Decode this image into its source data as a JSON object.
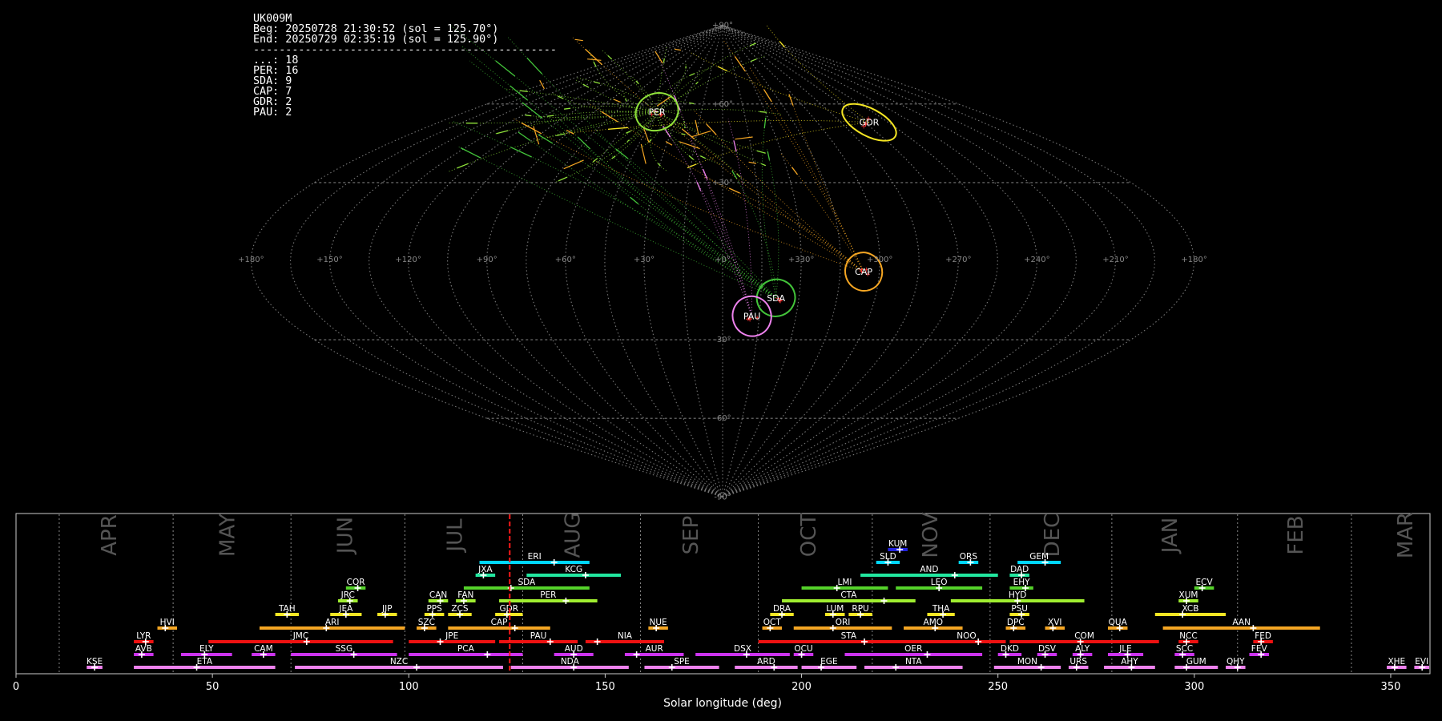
{
  "info": {
    "station": "UK009M",
    "beg": "Beg: 20250728 21:30:52 (sol = 125.70°)",
    "end": "End: 20250729 02:35:19 (sol = 125.90°)",
    "separator": "-----------------------------------------------",
    "counts": [
      "...: 18",
      "PER: 16",
      "SDA: 9",
      "CAP: 7",
      "GDR: 2",
      "PAU: 2"
    ]
  },
  "colors": {
    "grid": "#777777",
    "PER": "#8fe23a",
    "SDA": "#43c43a",
    "CAP": "#f5a623",
    "GDR": "#f5e623",
    "PAU": "#ee82ee",
    "sporadic": "#f5a623",
    "marker": "#ff3030"
  },
  "sky_map": {
    "projection": "sinusoidal",
    "lon_labels": [
      "+180°",
      "+150°",
      "+120°",
      "+90°",
      "+60°",
      "+30°",
      "+0°",
      "+330°",
      "+300°",
      "+270°",
      "+240°",
      "+210°",
      "+180°"
    ],
    "lat_labels": [
      "+90°",
      "+60°",
      "+30°",
      "-30°",
      "-60°",
      "-90°"
    ],
    "radiants": [
      {
        "code": "PER",
        "lon": 46,
        "lat": 57,
        "rx": 27,
        "ry": 23,
        "color": "#8fe23a"
      },
      {
        "code": "GDR",
        "lon": 267,
        "lat": 53,
        "rx": 37,
        "ry": 17,
        "color": "#f5e623"
      },
      {
        "code": "CAP",
        "lon": 306,
        "lat": -4,
        "rx": 23,
        "ry": 24,
        "color": "#f5a623"
      },
      {
        "code": "SDA",
        "lon": 339,
        "lat": -14,
        "rx": 24,
        "ry": 23,
        "color": "#43c43a"
      },
      {
        "code": "PAU",
        "lon": 348,
        "lat": -21,
        "rx": 24,
        "ry": 25,
        "color": "#ee82ee"
      }
    ]
  },
  "chart_data": {
    "type": "bar",
    "xlabel": "Solar longitude (deg)",
    "xlim": [
      0,
      360
    ],
    "xticks": [
      0,
      50,
      100,
      150,
      200,
      250,
      300,
      350
    ],
    "current_sol": 125.7,
    "months": [
      {
        "name": "APR",
        "sol": 24
      },
      {
        "name": "MAY",
        "sol": 54
      },
      {
        "name": "JUN",
        "sol": 84
      },
      {
        "name": "JUL",
        "sol": 112
      },
      {
        "name": "AUG",
        "sol": 142
      },
      {
        "name": "SEP",
        "sol": 172
      },
      {
        "name": "OCT",
        "sol": 202
      },
      {
        "name": "NOV",
        "sol": 233
      },
      {
        "name": "DEC",
        "sol": 264
      },
      {
        "name": "JAN",
        "sol": 294
      },
      {
        "name": "FEB",
        "sol": 326
      },
      {
        "name": "MAR",
        "sol": 354
      }
    ],
    "month_boundaries": [
      11,
      40,
      70,
      99,
      129,
      159,
      189,
      218,
      248,
      279,
      311,
      340
    ],
    "showers": [
      {
        "code": "KUM",
        "start": 222,
        "end": 227,
        "peak": 225,
        "row": 0,
        "color": "#2222dd"
      },
      {
        "code": "ERI",
        "start": 118,
        "end": 146,
        "peak": 137,
        "row": 1,
        "color": "#00d7ff"
      },
      {
        "code": "SLD",
        "start": 219,
        "end": 225,
        "peak": 222,
        "row": 1,
        "color": "#00d7ff"
      },
      {
        "code": "ORS",
        "start": 240,
        "end": 245,
        "peak": 243,
        "row": 1,
        "color": "#00d7ff"
      },
      {
        "code": "GEM",
        "start": 255,
        "end": 266,
        "peak": 262,
        "row": 1,
        "color": "#00d7ff"
      },
      {
        "code": "JXA",
        "start": 117,
        "end": 122,
        "peak": 119,
        "row": 2,
        "color": "#22e8a0"
      },
      {
        "code": "KCG",
        "start": 130,
        "end": 154,
        "peak": 145,
        "row": 2,
        "color": "#22e8a0"
      },
      {
        "code": "AND",
        "start": 215,
        "end": 250,
        "peak": 239,
        "row": 2,
        "color": "#22e8a0"
      },
      {
        "code": "DAD",
        "start": 253,
        "end": 258,
        "peak": 256,
        "row": 2,
        "color": "#22e8a0"
      },
      {
        "code": "COR",
        "start": 84,
        "end": 89,
        "peak": 87,
        "row": 3,
        "color": "#55d22a"
      },
      {
        "code": "SDA",
        "start": 114,
        "end": 146,
        "peak": 126,
        "row": 3,
        "color": "#55d22a"
      },
      {
        "code": "LMI",
        "start": 200,
        "end": 222,
        "peak": 209,
        "row": 3,
        "color": "#55d22a"
      },
      {
        "code": "LEO",
        "start": 224,
        "end": 246,
        "peak": 235,
        "row": 3,
        "color": "#55d22a"
      },
      {
        "code": "EHY",
        "start": 253,
        "end": 259,
        "peak": 257,
        "row": 3,
        "color": "#55d22a"
      },
      {
        "code": "ECV",
        "start": 300,
        "end": 305,
        "peak": 302,
        "row": 3,
        "color": "#55d22a"
      },
      {
        "code": "JRC",
        "start": 82,
        "end": 87,
        "peak": 85,
        "row": 4,
        "color": "#a0ee30"
      },
      {
        "code": "CAN",
        "start": 105,
        "end": 110,
        "peak": 108,
        "row": 4,
        "color": "#a0ee30"
      },
      {
        "code": "FAN",
        "start": 112,
        "end": 117,
        "peak": 114,
        "row": 4,
        "color": "#a0ee30"
      },
      {
        "code": "PER",
        "start": 123,
        "end": 148,
        "peak": 140,
        "row": 4,
        "color": "#a0ee30"
      },
      {
        "code": "CTA",
        "start": 195,
        "end": 229,
        "peak": 221,
        "row": 4,
        "color": "#a0ee30"
      },
      {
        "code": "HYD",
        "start": 238,
        "end": 272,
        "peak": 255,
        "row": 4,
        "color": "#a0ee30"
      },
      {
        "code": "XUM",
        "start": 296,
        "end": 301,
        "peak": 298,
        "row": 4,
        "color": "#a0ee30"
      },
      {
        "code": "TAH",
        "start": 66,
        "end": 72,
        "peak": 69,
        "row": 5,
        "color": "#f5e623"
      },
      {
        "code": "JEA",
        "start": 80,
        "end": 88,
        "peak": 84,
        "row": 5,
        "color": "#f5e623"
      },
      {
        "code": "JIP",
        "start": 92,
        "end": 97,
        "peak": 94,
        "row": 5,
        "color": "#f5e623"
      },
      {
        "code": "PPS",
        "start": 104,
        "end": 109,
        "peak": 106,
        "row": 5,
        "color": "#f5e623"
      },
      {
        "code": "ZCS",
        "start": 110,
        "end": 116,
        "peak": 113,
        "row": 5,
        "color": "#f5e623"
      },
      {
        "code": "GDR",
        "start": 122,
        "end": 129,
        "peak": 125,
        "row": 5,
        "color": "#f5e623"
      },
      {
        "code": "DRA",
        "start": 192,
        "end": 198,
        "peak": 195,
        "row": 5,
        "color": "#f5e623"
      },
      {
        "code": "LUM",
        "start": 206,
        "end": 211,
        "peak": 208,
        "row": 5,
        "color": "#f5e623"
      },
      {
        "code": "RPU",
        "start": 212,
        "end": 218,
        "peak": 215,
        "row": 5,
        "color": "#f5e623"
      },
      {
        "code": "THA",
        "start": 232,
        "end": 239,
        "peak": 236,
        "row": 5,
        "color": "#f5e623"
      },
      {
        "code": "PSU",
        "start": 253,
        "end": 258,
        "peak": 256,
        "row": 5,
        "color": "#f5e623"
      },
      {
        "code": "XCB",
        "start": 290,
        "end": 308,
        "peak": 297,
        "row": 5,
        "color": "#f5e623"
      },
      {
        "code": "HVI",
        "start": 36,
        "end": 41,
        "peak": 38,
        "row": 6,
        "color": "#f5a623"
      },
      {
        "code": "ARI",
        "start": 62,
        "end": 99,
        "peak": 79,
        "row": 6,
        "color": "#f5a623"
      },
      {
        "code": "SZC",
        "start": 102,
        "end": 107,
        "peak": 104,
        "row": 6,
        "color": "#f5a623"
      },
      {
        "code": "CAP",
        "start": 110,
        "end": 136,
        "peak": 127,
        "row": 6,
        "color": "#f5a623"
      },
      {
        "code": "NUE",
        "start": 161,
        "end": 166,
        "peak": 163,
        "row": 6,
        "color": "#f5a623"
      },
      {
        "code": "OCT",
        "start": 190,
        "end": 195,
        "peak": 192,
        "row": 6,
        "color": "#f5a623"
      },
      {
        "code": "ORI",
        "start": 198,
        "end": 223,
        "peak": 208,
        "row": 6,
        "color": "#f5a623"
      },
      {
        "code": "AMO",
        "start": 226,
        "end": 241,
        "peak": 234,
        "row": 6,
        "color": "#f5a623"
      },
      {
        "code": "DPC",
        "start": 252,
        "end": 257,
        "peak": 254,
        "row": 6,
        "color": "#f5a623"
      },
      {
        "code": "XVI",
        "start": 262,
        "end": 267,
        "peak": 264,
        "row": 6,
        "color": "#f5a623"
      },
      {
        "code": "QUA",
        "start": 278,
        "end": 283,
        "peak": 281,
        "row": 6,
        "color": "#f5a623"
      },
      {
        "code": "AAN",
        "start": 292,
        "end": 332,
        "peak": 315,
        "row": 6,
        "color": "#f5a623"
      },
      {
        "code": "LYR",
        "start": 30,
        "end": 35,
        "peak": 33,
        "row": 7,
        "color": "#ee1111"
      },
      {
        "code": "JMC",
        "start": 49,
        "end": 96,
        "peak": 74,
        "row": 7,
        "color": "#ee1111"
      },
      {
        "code": "JPE",
        "start": 100,
        "end": 122,
        "peak": 108,
        "row": 7,
        "color": "#ee1111"
      },
      {
        "code": "PAU",
        "start": 123,
        "end": 143,
        "peak": 136,
        "row": 7,
        "color": "#ee1111"
      },
      {
        "code": "NIA",
        "start": 145,
        "end": 165,
        "peak": 148,
        "row": 7,
        "color": "#ee1111"
      },
      {
        "code": "STA",
        "start": 189,
        "end": 235,
        "peak": 216,
        "row": 7,
        "color": "#ee1111"
      },
      {
        "code": "NOO",
        "start": 232,
        "end": 252,
        "peak": 245,
        "row": 7,
        "color": "#ee1111"
      },
      {
        "code": "COM",
        "start": 253,
        "end": 291,
        "peak": 271,
        "row": 7,
        "color": "#ee1111"
      },
      {
        "code": "NCC",
        "start": 296,
        "end": 301,
        "peak": 298,
        "row": 7,
        "color": "#ee1111"
      },
      {
        "code": "FED",
        "start": 315,
        "end": 320,
        "peak": 317,
        "row": 7,
        "color": "#ee1111"
      },
      {
        "code": "AVB",
        "start": 30,
        "end": 35,
        "peak": 32,
        "row": 8,
        "color": "#cc33ee"
      },
      {
        "code": "ELY",
        "start": 42,
        "end": 55,
        "peak": 48,
        "row": 8,
        "color": "#cc33ee"
      },
      {
        "code": "CAM",
        "start": 60,
        "end": 66,
        "peak": 63,
        "row": 8,
        "color": "#cc33ee"
      },
      {
        "code": "SSG",
        "start": 70,
        "end": 97,
        "peak": 86,
        "row": 8,
        "color": "#cc33ee"
      },
      {
        "code": "PCA",
        "start": 100,
        "end": 129,
        "peak": 120,
        "row": 8,
        "color": "#cc33ee"
      },
      {
        "code": "AUD",
        "start": 137,
        "end": 147,
        "peak": 142,
        "row": 8,
        "color": "#cc33ee"
      },
      {
        "code": "AUR",
        "start": 155,
        "end": 170,
        "peak": 158,
        "row": 8,
        "color": "#cc33ee"
      },
      {
        "code": "DSX",
        "start": 173,
        "end": 197,
        "peak": 186,
        "row": 8,
        "color": "#cc33ee"
      },
      {
        "code": "OCU",
        "start": 198,
        "end": 203,
        "peak": 200,
        "row": 8,
        "color": "#cc33ee"
      },
      {
        "code": "OER",
        "start": 211,
        "end": 246,
        "peak": 232,
        "row": 8,
        "color": "#cc33ee"
      },
      {
        "code": "DKD",
        "start": 250,
        "end": 256,
        "peak": 252,
        "row": 8,
        "color": "#cc33ee"
      },
      {
        "code": "DSV",
        "start": 260,
        "end": 265,
        "peak": 262,
        "row": 8,
        "color": "#cc33ee"
      },
      {
        "code": "ALY",
        "start": 269,
        "end": 274,
        "peak": 271,
        "row": 8,
        "color": "#cc33ee"
      },
      {
        "code": "JLE",
        "start": 278,
        "end": 287,
        "peak": 283,
        "row": 8,
        "color": "#cc33ee"
      },
      {
        "code": "SCC",
        "start": 295,
        "end": 300,
        "peak": 297,
        "row": 8,
        "color": "#cc33ee"
      },
      {
        "code": "FEV",
        "start": 314,
        "end": 319,
        "peak": 317,
        "row": 8,
        "color": "#cc33ee"
      },
      {
        "code": "KSE",
        "start": 18,
        "end": 22,
        "peak": 20,
        "row": 9,
        "color": "#ee82ee"
      },
      {
        "code": "ETA",
        "start": 30,
        "end": 66,
        "peak": 46,
        "row": 9,
        "color": "#ee82ee"
      },
      {
        "code": "NZC",
        "start": 71,
        "end": 124,
        "peak": 102,
        "row": 9,
        "color": "#ee82ee"
      },
      {
        "code": "NDA",
        "start": 126,
        "end": 156,
        "peak": 142,
        "row": 9,
        "color": "#ee82ee"
      },
      {
        "code": "SPE",
        "start": 160,
        "end": 179,
        "peak": 167,
        "row": 9,
        "color": "#ee82ee"
      },
      {
        "code": "ARD",
        "start": 183,
        "end": 199,
        "peak": 193,
        "row": 9,
        "color": "#ee82ee"
      },
      {
        "code": "EGE",
        "start": 200,
        "end": 214,
        "peak": 205,
        "row": 9,
        "color": "#ee82ee"
      },
      {
        "code": "NTA",
        "start": 216,
        "end": 241,
        "peak": 224,
        "row": 9,
        "color": "#ee82ee"
      },
      {
        "code": "MON",
        "start": 249,
        "end": 266,
        "peak": 261,
        "row": 9,
        "color": "#ee82ee"
      },
      {
        "code": "URS",
        "start": 268,
        "end": 273,
        "peak": 270,
        "row": 9,
        "color": "#ee82ee"
      },
      {
        "code": "AHY",
        "start": 277,
        "end": 290,
        "peak": 284,
        "row": 9,
        "color": "#ee82ee"
      },
      {
        "code": "GUM",
        "start": 295,
        "end": 306,
        "peak": 298,
        "row": 9,
        "color": "#ee82ee"
      },
      {
        "code": "QHY",
        "start": 308,
        "end": 313,
        "peak": 311,
        "row": 9,
        "color": "#ee82ee"
      },
      {
        "code": "XHE",
        "start": 349,
        "end": 354,
        "peak": 351,
        "row": 9,
        "color": "#ee82ee"
      },
      {
        "code": "EVI",
        "start": 356,
        "end": 361,
        "peak": 358,
        "row": 9,
        "color": "#ee82ee"
      }
    ]
  }
}
